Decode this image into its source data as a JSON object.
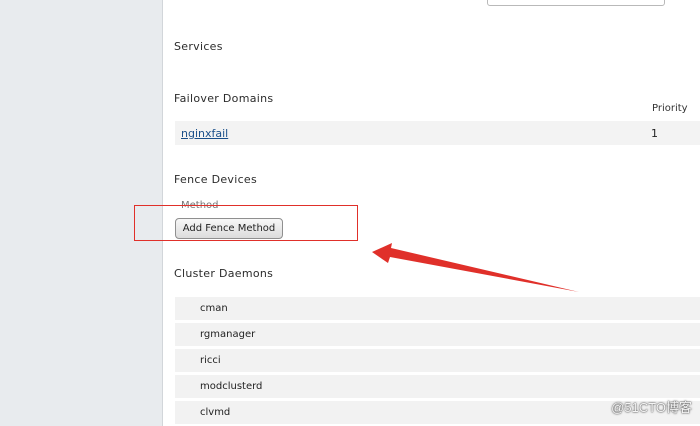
{
  "sections": {
    "services": "Services",
    "failover_domains": "Failover Domains",
    "fence_devices": "Fence Devices",
    "cluster_daemons": "Cluster Daemons"
  },
  "failover_domains": {
    "priority_header": "Priority",
    "rows": [
      {
        "name": "nginxfail",
        "priority": "1"
      }
    ]
  },
  "fence": {
    "method_label": "Method",
    "add_button": "Add Fence Method"
  },
  "daemons": [
    "cman",
    "rgmanager",
    "ricci",
    "modclusterd",
    "clvmd"
  ],
  "annotation": {
    "box_color": "#e0302a",
    "arrow_color": "#e0302a"
  },
  "watermark": "@51CTO博客"
}
